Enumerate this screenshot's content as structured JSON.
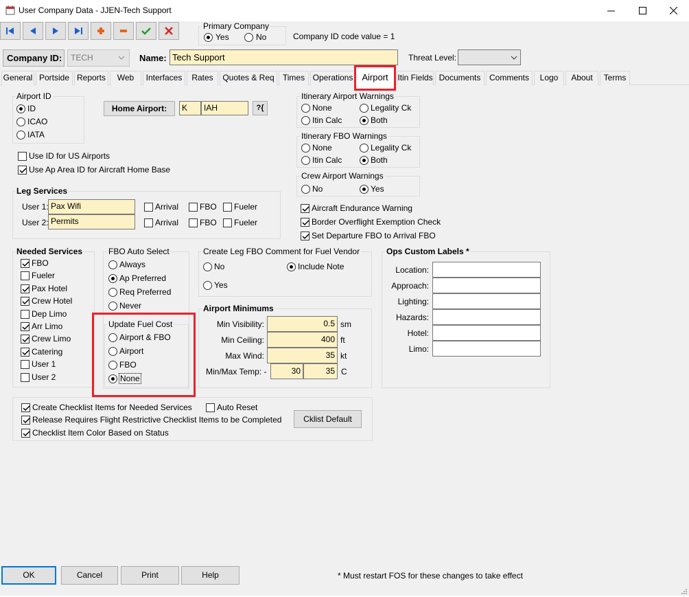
{
  "window": {
    "title": "User Company Data - JJEN-Tech Support"
  },
  "toolbar": {
    "buttons": [
      "first-record",
      "previous-record",
      "next-record",
      "last-record",
      "add-record",
      "delete-record",
      "save-record",
      "cancel-edit"
    ]
  },
  "primary_company": {
    "label": "Primary Company",
    "options": [
      "Yes",
      "No"
    ],
    "selected": "Yes"
  },
  "company_id_code": "Company ID code value = 1",
  "company": {
    "id_label": "Company ID:",
    "id_value": "TECH",
    "name_label": "Name:",
    "name_value": "Tech Support",
    "threat_label": "Threat Level:",
    "threat_value": ""
  },
  "tabs": [
    "General",
    "Portside",
    "Reports",
    "Web",
    "Interfaces",
    "Rates",
    "Quotes & Req",
    "Times",
    "Operations",
    "Airport",
    "Itin Fields",
    "Documents",
    "Comments",
    "Logo",
    "About",
    "Terms"
  ],
  "active_tab": "Airport",
  "airport_id": {
    "label": "Airport ID",
    "options": [
      "ID",
      "ICAO",
      "IATA"
    ],
    "selected": "ID"
  },
  "home_airport": {
    "label": "Home Airport:",
    "prefix": "K",
    "code": "IAH",
    "lookup": "?{"
  },
  "itin_airport_warnings": {
    "label": "Itinerary Airport Warnings",
    "options": [
      "None",
      "Legality Ck",
      "Itin Calc",
      "Both"
    ],
    "selected": "Both"
  },
  "itin_fbo_warnings": {
    "label": "Itinerary FBO Warnings",
    "options": [
      "None",
      "Legality Ck",
      "Itin Calc",
      "Both"
    ],
    "selected": "Both"
  },
  "crew_airport_warnings": {
    "label": "Crew Airport Warnings",
    "options": [
      "No",
      "Yes"
    ],
    "selected": "Yes"
  },
  "checks_top": [
    {
      "label": "Use ID for US Airports",
      "checked": false
    },
    {
      "label": "Use Ap Area ID for Aircraft Home Base",
      "checked": true
    }
  ],
  "checks_right": [
    {
      "label": "Aircraft Endurance Warning",
      "checked": true
    },
    {
      "label": "Border Overflight Exemption Check",
      "checked": true
    },
    {
      "label": "Set Departure FBO to Arrival FBO",
      "checked": true
    }
  ],
  "leg_services": {
    "label": "Leg Services",
    "rows": [
      {
        "label": "User 1:",
        "value": "Pax Wifi",
        "arrival": false,
        "fbo": false,
        "fueler": false
      },
      {
        "label": "User 2:",
        "value": "Permits",
        "arrival": false,
        "fbo": false,
        "fueler": false
      }
    ],
    "col_labels": [
      "Arrival",
      "FBO",
      "Fueler"
    ]
  },
  "needed_services": {
    "label": "Needed Services",
    "items": [
      {
        "label": "FBO",
        "checked": true
      },
      {
        "label": "Fueler",
        "checked": false
      },
      {
        "label": "Pax Hotel",
        "checked": true
      },
      {
        "label": "Crew Hotel",
        "checked": true
      },
      {
        "label": "Dep Limo",
        "checked": false
      },
      {
        "label": "Arr Limo",
        "checked": true
      },
      {
        "label": "Crew Limo",
        "checked": true
      },
      {
        "label": "Catering",
        "checked": true
      },
      {
        "label": "User 1",
        "checked": false
      },
      {
        "label": "User 2",
        "checked": false
      }
    ]
  },
  "fbo_auto_select": {
    "label": "FBO Auto Select",
    "options": [
      "Always",
      "Ap Preferred",
      "Req Preferred",
      "Never"
    ],
    "selected": "Ap Preferred"
  },
  "update_fuel_cost": {
    "label": "Update Fuel Cost",
    "options": [
      "Airport & FBO",
      "Airport",
      "FBO",
      "None"
    ],
    "selected": "None"
  },
  "leg_fbo_comment": {
    "label": "Create Leg FBO Comment for Fuel Vendor",
    "options": [
      "No",
      "Include Note",
      "Yes"
    ],
    "selected": "Include Note"
  },
  "airport_minimums": {
    "label": "Airport Minimums",
    "rows": [
      {
        "label": "Min Visibility:",
        "value": "0.5",
        "unit": "sm"
      },
      {
        "label": "Min Ceiling:",
        "value": "400",
        "unit": "ft"
      },
      {
        "label": "Max Wind:",
        "value": "35",
        "unit": "kt"
      }
    ],
    "temp": {
      "label": "Min/Max Temp: -",
      "min": "30",
      "max": "35",
      "unit": "C"
    }
  },
  "ops_custom_labels": {
    "label": "Ops Custom Labels *",
    "fields": [
      {
        "label": "Location:",
        "value": ""
      },
      {
        "label": "Approach:",
        "value": ""
      },
      {
        "label": "Lighting:",
        "value": ""
      },
      {
        "label": "Hazards:",
        "value": ""
      },
      {
        "label": "Hotel:",
        "value": ""
      },
      {
        "label": "Limo:",
        "value": ""
      }
    ]
  },
  "checklist": {
    "items": [
      {
        "label": "Create Checklist Items for Needed Services",
        "checked": true
      },
      {
        "label": "Release Requires Flight Restrictive Checklist Items to be Completed",
        "checked": true
      },
      {
        "label": "Checklist Item Color Based on Status",
        "checked": true
      }
    ],
    "auto_reset": {
      "label": "Auto Reset",
      "checked": false
    },
    "default_button": "Cklist Default"
  },
  "bottom": {
    "ok": "OK",
    "cancel": "Cancel",
    "print": "Print",
    "help": "Help",
    "note": "* Must restart FOS for these changes to take effect"
  },
  "colors": {
    "highlight": "#e8222c",
    "field_yellow": "#fdf2c6",
    "nav_blue": "#1a5fcf"
  }
}
